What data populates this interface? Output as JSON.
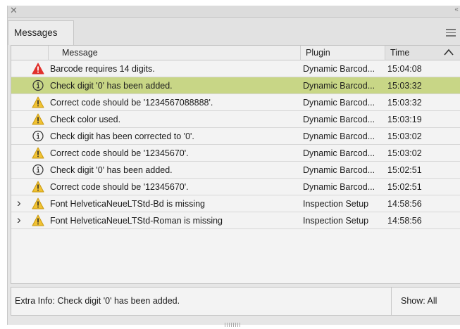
{
  "panel": {
    "tab_label": "Messages"
  },
  "columns": {
    "message": "Message",
    "plugin": "Plugin",
    "time": "Time"
  },
  "rows": [
    {
      "type": "error",
      "message": "Barcode requires 14 digits.",
      "plugin": "Dynamic Barcod...",
      "time": "15:04:08",
      "selected": false,
      "expandable": false
    },
    {
      "type": "info",
      "message": "Check digit '0' has been added.",
      "plugin": "Dynamic Barcod...",
      "time": "15:03:32",
      "selected": true,
      "expandable": false
    },
    {
      "type": "warning",
      "message": "Correct code should be '1234567088888'.",
      "plugin": "Dynamic Barcod...",
      "time": "15:03:32",
      "selected": false,
      "expandable": false
    },
    {
      "type": "warning",
      "message": "Check color used.",
      "plugin": "Dynamic Barcod...",
      "time": "15:03:19",
      "selected": false,
      "expandable": false
    },
    {
      "type": "info",
      "message": "Check digit has been corrected to '0'.",
      "plugin": "Dynamic Barcod...",
      "time": "15:03:02",
      "selected": false,
      "expandable": false
    },
    {
      "type": "warning",
      "message": "Correct code should be '12345670'.",
      "plugin": "Dynamic Barcod...",
      "time": "15:03:02",
      "selected": false,
      "expandable": false
    },
    {
      "type": "info",
      "message": "Check digit '0' has been added.",
      "plugin": "Dynamic Barcod...",
      "time": "15:02:51",
      "selected": false,
      "expandable": false
    },
    {
      "type": "warning",
      "message": "Correct code should be '12345670'.",
      "plugin": "Dynamic Barcod...",
      "time": "15:02:51",
      "selected": false,
      "expandable": false
    },
    {
      "type": "warning",
      "message": "Font HelveticaNeueLTStd-Bd is missing",
      "plugin": "Inspection Setup",
      "time": "14:58:56",
      "selected": false,
      "expandable": true
    },
    {
      "type": "warning",
      "message": "Font HelveticaNeueLTStd-Roman is missing",
      "plugin": "Inspection Setup",
      "time": "14:58:56",
      "selected": false,
      "expandable": true
    }
  ],
  "footer": {
    "extra_info": "Extra Info: Check digit '0' has been added.",
    "show_filter": "Show: All"
  },
  "colors": {
    "selected_row": "#c8d686",
    "error_icon": "#e0312c",
    "warning_icon": "#f1c232"
  }
}
